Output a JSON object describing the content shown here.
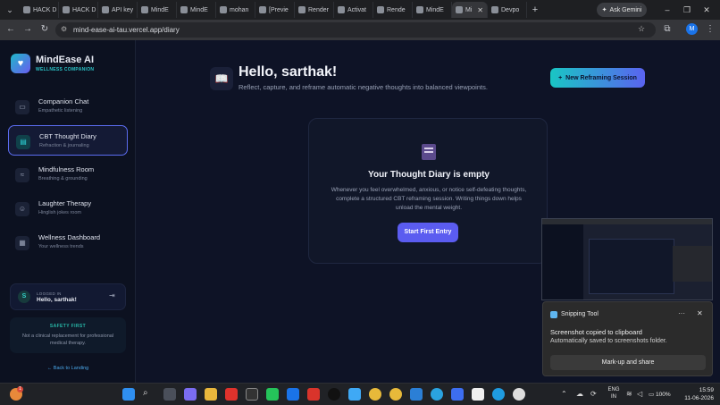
{
  "browser": {
    "tabs": [
      {
        "label": "HACK D",
        "active": false
      },
      {
        "label": "HACK D",
        "active": false
      },
      {
        "label": "API key",
        "active": false
      },
      {
        "label": "MindE",
        "active": false
      },
      {
        "label": "MindE",
        "active": false
      },
      {
        "label": "mohan",
        "active": false
      },
      {
        "label": "[Previe",
        "active": false
      },
      {
        "label": "Render",
        "active": false
      },
      {
        "label": "Activat",
        "active": false
      },
      {
        "label": "Rende",
        "active": false
      },
      {
        "label": "MindE",
        "active": false
      },
      {
        "label": "Mi",
        "active": true
      },
      {
        "label": "Devpo",
        "active": false
      }
    ],
    "ask_gemini": "Ask Gemini",
    "url": "mind-ease-ai-tau.vercel.app/diary",
    "profile_initial": "M"
  },
  "sidebar": {
    "brand_name": "MindEase AI",
    "brand_sub": "WELLNESS COMPANION",
    "items": [
      {
        "title": "Companion Chat",
        "sub": "Empathetic listening",
        "icon": "chat-icon",
        "active": false
      },
      {
        "title": "CBT Thought Diary",
        "sub": "Refraction & journaling",
        "icon": "book-icon",
        "active": true
      },
      {
        "title": "Mindfulness Room",
        "sub": "Breathing & grounding",
        "icon": "wind-icon",
        "active": false
      },
      {
        "title": "Laughter Therapy",
        "sub": "Hinglish jokes room",
        "icon": "smile-icon",
        "active": false
      },
      {
        "title": "Wellness Dashboard",
        "sub": "Your wellness trends",
        "icon": "dashboard-icon",
        "active": false
      }
    ],
    "user": {
      "label": "LOGGED IN",
      "name": "Hello, sarthak!",
      "initial": "S"
    },
    "safety": {
      "title": "SAFETY FIRST",
      "text": "Not a clinical replacement for professional medical therapy."
    },
    "back_link": "← Back to Landing"
  },
  "main": {
    "greeting": "Hello, sarthak!",
    "subtitle": "Reflect, capture, and reframe automatic negative thoughts into balanced viewpoints.",
    "new_session": "New Reframing Session",
    "empty": {
      "title": "Your Thought Diary is empty",
      "text": "Whenever you feel overwhelmed, anxious, or notice self-defeating thoughts, complete a structured CBT reframing session. Writing things down helps unload the mental weight.",
      "button": "Start First Entry"
    }
  },
  "toast": {
    "app": "Snipping Tool",
    "title": "Screenshot copied to clipboard",
    "message": "Automatically saved to screenshots folder.",
    "button": "Mark-up and share"
  },
  "taskbar": {
    "lang_line1": "ENG",
    "lang_line2": "IN",
    "battery": "100%",
    "time": "15:59",
    "date": "11-06-2026",
    "weather_badge": "1"
  },
  "colors": {
    "accent_teal": "#19c6c4",
    "accent_indigo": "#5b5cf0",
    "bg": "#0e1326"
  }
}
